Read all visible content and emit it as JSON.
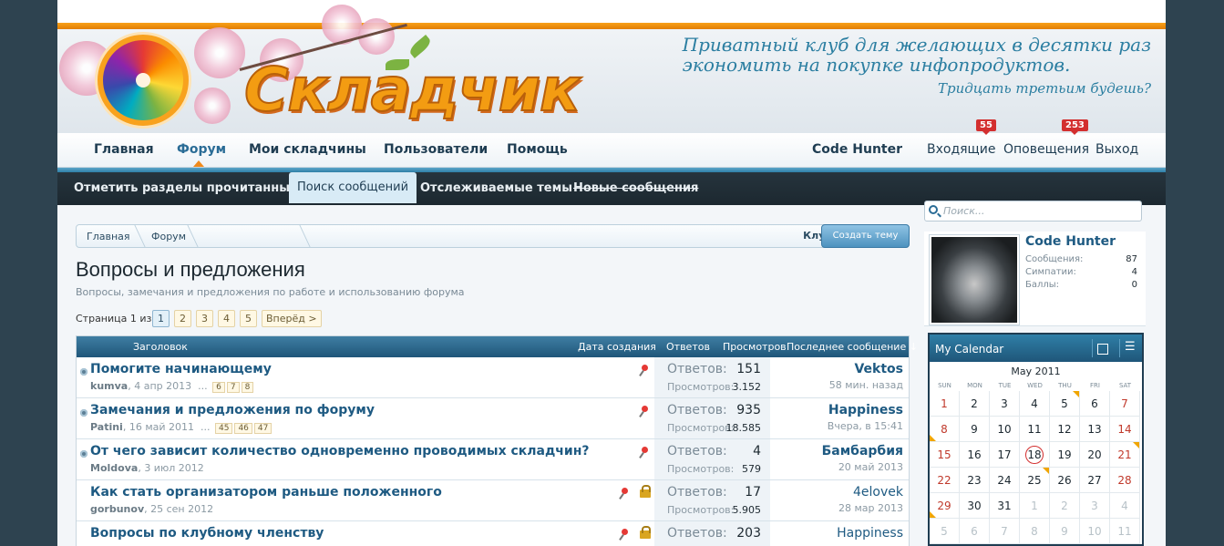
{
  "header": {
    "logo_text": "Складчик",
    "slogan_line1": "Приватный клуб для желающих в десятки раз",
    "slogan_line2": "экономить на покупке инфопродуктов.",
    "slogan_line3": "Тридцать третьим будешь?"
  },
  "nav": {
    "items": [
      "Главная",
      "Форум",
      "Мои складчины",
      "Пользователи",
      "Помощь"
    ],
    "username": "Code Hunter",
    "inbox_label": "Входящие",
    "inbox_count": "55",
    "alerts_label": "Оповещения",
    "alerts_count": "253",
    "logout_label": "Выход"
  },
  "subnav": {
    "items": [
      "Отметить разделы прочитанными",
      "Поиск сообщений",
      "Отслеживаемые темы",
      "Новые сообщения"
    ]
  },
  "breadcrumb": [
    "Главная",
    "Форум",
    "Клуб \"Складчик\""
  ],
  "create_thread": "Создать тему",
  "page": {
    "title": "Вопросы и предложения",
    "description": "Вопросы, замечания и предложения по работе и использованию форума"
  },
  "pager": {
    "label": "Страница 1 из 5",
    "pages": [
      "1",
      "2",
      "3",
      "4",
      "5"
    ],
    "next": "Вперёд >"
  },
  "table": {
    "headers": {
      "title": "Заголовок",
      "created": "Дата создания",
      "replies": "Ответов",
      "views": "Просмотров",
      "last": "Последнее сообщение ↓"
    },
    "replies_label": "Ответов:",
    "views_label": "Просмотров:",
    "rows": [
      {
        "title": "Помогите начинающему",
        "author": "kumva",
        "date": "4 апр 2013",
        "pages": [
          "6",
          "7",
          "8"
        ],
        "replies": "151",
        "views": "3.152",
        "last_user": "Vektos",
        "last_time": "58 мин. назад",
        "pinned": true,
        "locked": false,
        "bold_last": true
      },
      {
        "title": "Замечания и предложения по форуму",
        "author": "Patini",
        "date": "16 май 2011",
        "pages": [
          "45",
          "46",
          "47"
        ],
        "replies": "935",
        "views": "18.585",
        "last_user": "Happiness",
        "last_time": "Вчера, в 15:41",
        "pinned": true,
        "locked": false,
        "bold_last": true
      },
      {
        "title": "От чего зависит количество одновременно проводимых складчин?",
        "author": "Moldova",
        "date": "3 июл 2012",
        "pages": [],
        "replies": "4",
        "views": "579",
        "last_user": "Бамбарбия",
        "last_time": "20 май 2013",
        "pinned": true,
        "locked": false,
        "bold_last": true
      },
      {
        "title": "Как стать организатором раньше положенного",
        "author": "gorbunov",
        "date": "25 сен 2012",
        "pages": [],
        "replies": "17",
        "views": "5.905",
        "last_user": "4elovek",
        "last_time": "28 мар 2013",
        "pinned": true,
        "locked": true,
        "bold_last": false
      },
      {
        "title": "Вопросы по клубному членству",
        "author": "",
        "date": "",
        "pages": [],
        "replies": "203",
        "views": "",
        "last_user": "Happiness",
        "last_time": "",
        "pinned": true,
        "locked": true,
        "bold_last": false
      }
    ]
  },
  "sidebar": {
    "search_placeholder": "Поиск...",
    "profile": {
      "name": "Code Hunter",
      "messages_label": "Сообщения:",
      "messages": "87",
      "likes_label": "Симпатии:",
      "likes": "4",
      "points_label": "Баллы:",
      "points": "0"
    },
    "calendar": {
      "title": "My Calendar",
      "month": "May 2011",
      "dow": [
        "SUN",
        "MON",
        "TUE",
        "WED",
        "THU",
        "FRI",
        "SAT"
      ],
      "days": [
        "1",
        "2",
        "3",
        "4",
        "5",
        "6",
        "7",
        "8",
        "9",
        "10",
        "11",
        "12",
        "13",
        "14",
        "15",
        "16",
        "17",
        "18",
        "19",
        "20",
        "21",
        "22",
        "23",
        "24",
        "25",
        "26",
        "27",
        "28",
        "29",
        "30",
        "31",
        "1",
        "2",
        "3",
        "4",
        "5",
        "6",
        "7",
        "8",
        "9",
        "10",
        "11"
      ]
    }
  },
  "colors": {
    "accent_orange": "#f39c12",
    "nav_text": "#1f3d52",
    "link_blue": "#1e5a82",
    "badge_red": "#d32f2f"
  }
}
